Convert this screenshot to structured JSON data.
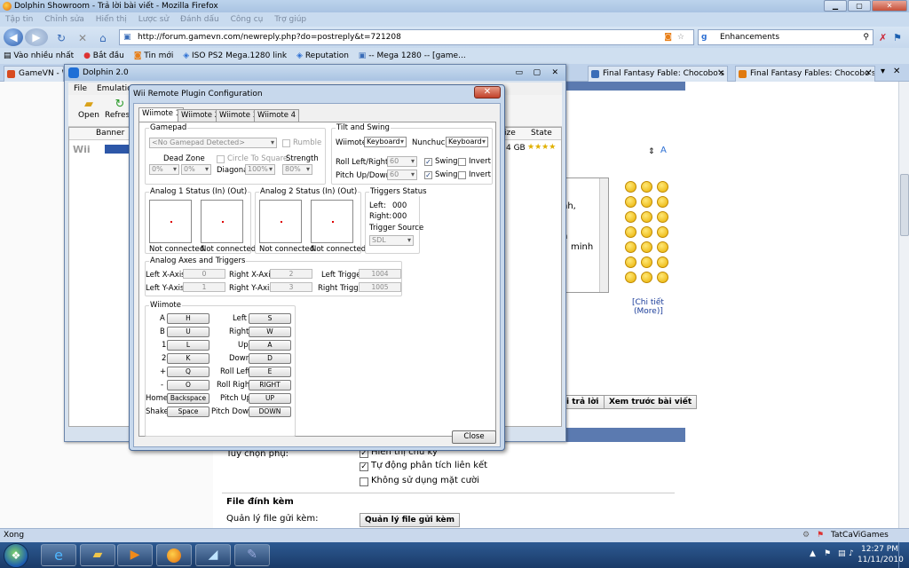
{
  "firefox": {
    "title": "Dolphin Showroom - Trả lời bài viết - Mozilla Firefox",
    "menu": [
      "Tập tin",
      "Chỉnh sửa",
      "Hiển thị",
      "Lược sử",
      "Đánh dấu",
      "Công cụ",
      "Trợ giúp"
    ],
    "url": "http://forum.gamevn.com/newreply.php?do=postreply&t=721208",
    "search": "Enhancements",
    "bookmarks": [
      "Vào nhiều nhất",
      "Bắt đầu",
      "Tin mới",
      "ISO PS2 Mega.1280 link",
      "Reputation",
      "-- Mega 1280 -- [game..."
    ],
    "tabs": [
      "GameVN - W",
      "Final Fantasy Fable: Chocobo's ...",
      "Final Fantasy Fables: Chocobo's ..."
    ],
    "status": "Xong",
    "status_right": "TatCaViGames"
  },
  "page": {
    "chi_tiet": "[Chi tiết",
    "more": "(More)]",
    "btn_reply": "i trả lời",
    "btn_preview": "Xem trước bài viết",
    "options_label": "Tùy chọn phụ:",
    "opt1": "Hiển thị chữ ký",
    "opt2": "Tự động phân tích liên kết",
    "opt3": "Không sử dụng mặt cười",
    "attach_title": "File đính kèm",
    "attach_label": "Quản lý file gửi kèm:",
    "attach_btn": "Quản lý file gửi kèm",
    "text_nh": "nh,",
    "text_c": "c",
    "text_h": "h",
    "text_minh": "minh"
  },
  "dolphin": {
    "title": "Dolphin 2.0",
    "menu": [
      "File",
      "Emulation"
    ],
    "open": "Open",
    "refresh": "Refresh",
    "col_banner": "Banner",
    "col_size": "ize",
    "col_state": "State",
    "row_platform": "Wii",
    "row_size": "4 GB",
    "row_stars": "★★★★"
  },
  "wii": {
    "title": "Wii Remote Plugin Configuration",
    "tabs": [
      "Wiimote 1",
      "Wiimote 2",
      "Wiimote 3",
      "Wiimote 4"
    ],
    "gamepad": {
      "title": "Gamepad",
      "device": "<No Gamepad Detected>",
      "rumble": "Rumble",
      "dead_zone": "Dead Zone",
      "dz1": "0%",
      "dz2": "0%",
      "circle": "Circle To Square",
      "diagonal": "Diagonal",
      "diag_val": "100%",
      "strength": "Strength",
      "strength_val": "80%"
    },
    "tilt": {
      "title": "Tilt and Swing",
      "wiimote": "Wiimote",
      "wiimote_val": "Keyboard",
      "nunchuck": "Nunchuck",
      "nunchuck_val": "Keyboard",
      "roll": "Roll Left/Right",
      "roll_val": "60",
      "pitch": "Pitch Up/Down",
      "pitch_val": "60",
      "swing": "Swing",
      "invert": "Invert"
    },
    "analog1": {
      "title": "Analog 1 Status (In) (Out)",
      "nc": "Not connected"
    },
    "analog2": {
      "title": "Analog 2 Status (In) (Out)",
      "nc": "Not connected"
    },
    "triggers": {
      "title": "Triggers Status",
      "left": "Left:",
      "left_val": "000",
      "right": "Right:",
      "right_val": "000",
      "source": "Trigger Source",
      "source_val": "SDL"
    },
    "axes": {
      "title": "Analog Axes and Triggers",
      "lx": "Left X-Axis",
      "lx_val": "0",
      "ly": "Left Y-Axis",
      "ly_val": "1",
      "rx": "Right X-Axis",
      "rx_val": "2",
      "ry": "Right Y-Axis",
      "ry_val": "3",
      "lt": "Left Trigger",
      "lt_val": "1004",
      "rt": "Right Trigger",
      "rt_val": "1005"
    },
    "wiimote": {
      "title": "Wiimote",
      "left_col": [
        {
          "label": "A",
          "key": "H"
        },
        {
          "label": "B",
          "key": "U"
        },
        {
          "label": "1",
          "key": "L"
        },
        {
          "label": "2",
          "key": "K"
        },
        {
          "label": "+",
          "key": "Q"
        },
        {
          "label": "-",
          "key": "O"
        },
        {
          "label": "Home",
          "key": "Backspace"
        },
        {
          "label": "Shake",
          "key": "Space"
        }
      ],
      "right_col": [
        {
          "label": "Left",
          "key": "S"
        },
        {
          "label": "Right",
          "key": "W"
        },
        {
          "label": "Up",
          "key": "A"
        },
        {
          "label": "Down",
          "key": "D"
        },
        {
          "label": "Roll Left",
          "key": "E"
        },
        {
          "label": "Roll Right",
          "key": "RIGHT"
        },
        {
          "label": "Pitch Up",
          "key": "UP"
        },
        {
          "label": "Pitch Down",
          "key": "DOWN"
        }
      ]
    },
    "close": "Close"
  },
  "taskbar": {
    "time": "12:27 PM",
    "date": "11/11/2010"
  }
}
